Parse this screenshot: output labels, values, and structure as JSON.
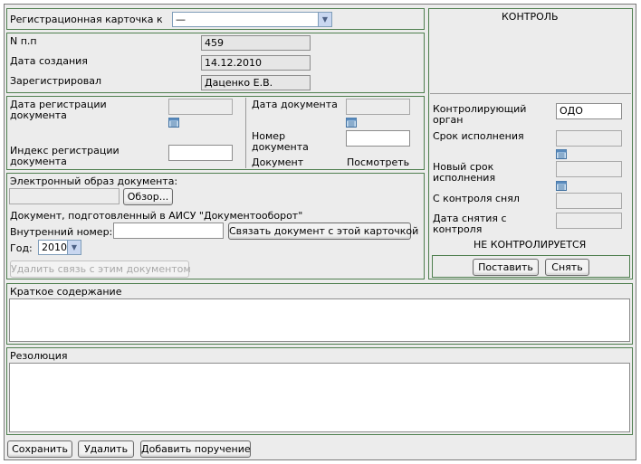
{
  "card": {
    "label": "Регистрационная карточка к",
    "selected": "—"
  },
  "info": {
    "num_label": "N п.п",
    "num_value": "459",
    "created_label": "Дата создания",
    "created_value": "14.12.2010",
    "registered_label": "Зарегистрировал",
    "registered_value": "Даценко Е.В."
  },
  "doc": {
    "reg_date_label": "Дата регистрации документа",
    "reg_index_label": "Индекс регистрации документа",
    "doc_date_label": "Дата документа",
    "doc_number_label": "Номер документа",
    "document_label": "Документ",
    "view_link": "Посмотреть"
  },
  "eimage": {
    "label": "Электронный образ документа:",
    "browse_button": "Обзор...",
    "aisu_label": "Документ, подготовленный в АИСУ \"Документооборот\"",
    "internal_label": "Внутренний номер:",
    "link_button": "Связать документ с этой карточкой",
    "year_label": "Год:",
    "year_value": "2010",
    "unlink_button": "Удалить связь с этим документом"
  },
  "control": {
    "title": "КОНТРОЛЬ",
    "organ_label": "Контролирующий орган",
    "organ_value": "ОДО",
    "deadline_label": "Срок исполнения",
    "new_deadline_label": "Новый срок исполнения",
    "removed_by_label": "С контроля снял",
    "removed_date_label": "Дата снятия с контроля",
    "status": "НЕ КОНТРОЛИРУЕТСЯ",
    "set_button": "Поставить",
    "remove_button": "Снять"
  },
  "summary": {
    "label": "Краткое содержание"
  },
  "resolution": {
    "label": "Резолюция"
  },
  "footer": {
    "save_button": "Сохранить",
    "delete_button": "Удалить",
    "add_order_button": "Добавить поручение"
  }
}
